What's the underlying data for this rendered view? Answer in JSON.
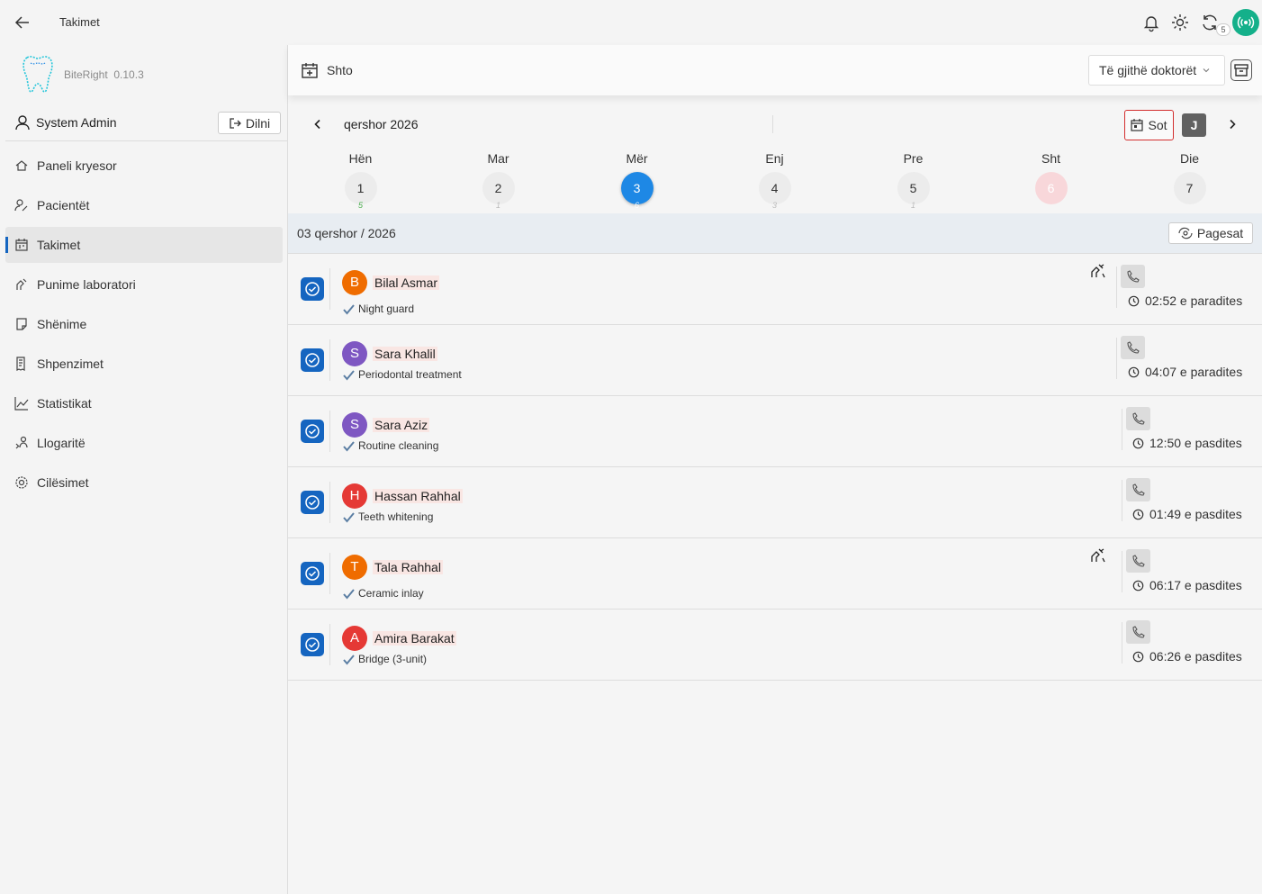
{
  "topbar": {
    "title": "Takimet",
    "sync_count": "5"
  },
  "sidebar": {
    "app_name": "BiteRight",
    "version": "0.10.3",
    "user_name": "System Admin",
    "logout_label": "Dilni",
    "items": [
      {
        "label": "Paneli kryesor",
        "icon": "home-icon"
      },
      {
        "label": "Pacientët",
        "icon": "users-icon"
      },
      {
        "label": "Takimet",
        "icon": "calendar-icon"
      },
      {
        "label": "Punime laboratori",
        "icon": "lab-icon"
      },
      {
        "label": "Shënime",
        "icon": "note-icon"
      },
      {
        "label": "Shpenzimet",
        "icon": "receipt-icon"
      },
      {
        "label": "Statistikat",
        "icon": "chart-icon"
      },
      {
        "label": "Llogaritë",
        "icon": "accounts-icon"
      },
      {
        "label": "Cilësimet",
        "icon": "gear-icon"
      }
    ]
  },
  "toolbar": {
    "add_label": "Shto",
    "doctor_select": "Të gjithë doktorët"
  },
  "calendar": {
    "month_label": "qershor 2026",
    "today_label": "Sot",
    "view_label": "J",
    "days": [
      {
        "name": "Hën",
        "num": "1",
        "count": "5"
      },
      {
        "name": "Mar",
        "num": "2",
        "count": "1"
      },
      {
        "name": "Mër",
        "num": "3",
        "count": "6"
      },
      {
        "name": "Enj",
        "num": "4",
        "count": "3"
      },
      {
        "name": "Pre",
        "num": "5",
        "count": "1"
      },
      {
        "name": "Sht",
        "num": "6",
        "count": ""
      },
      {
        "name": "Die",
        "num": "7",
        "count": ""
      }
    ]
  },
  "date_bar": {
    "date": "03 qershor / 2026",
    "payments_label": "Pagesat"
  },
  "appointments": [
    {
      "initial": "B",
      "name": "Bilal Asmar",
      "treatment": "Night guard",
      "time": "02:52 e paradites",
      "avatar_color": "#ef6c00",
      "lab": true
    },
    {
      "initial": "S",
      "name": "Sara Khalil",
      "treatment": "Periodontal treatment",
      "time": "04:07 e paradites",
      "avatar_color": "#7e57c2",
      "lab": false
    },
    {
      "initial": "S",
      "name": "Sara Aziz",
      "treatment": "Routine cleaning",
      "time": "12:50 e pasdites",
      "avatar_color": "#7e57c2",
      "lab": false
    },
    {
      "initial": "H",
      "name": "Hassan Rahhal",
      "treatment": "Teeth whitening",
      "time": "01:49 e pasdites",
      "avatar_color": "#e53935",
      "lab": false
    },
    {
      "initial": "T",
      "name": "Tala Rahhal",
      "treatment": "Ceramic inlay",
      "time": "06:17 e pasdites",
      "avatar_color": "#ef6c00",
      "lab": true
    },
    {
      "initial": "A",
      "name": "Amira Barakat",
      "treatment": "Bridge (3-unit)",
      "time": "06:26 e pasdites",
      "avatar_color": "#e53935",
      "lab": false
    }
  ]
}
